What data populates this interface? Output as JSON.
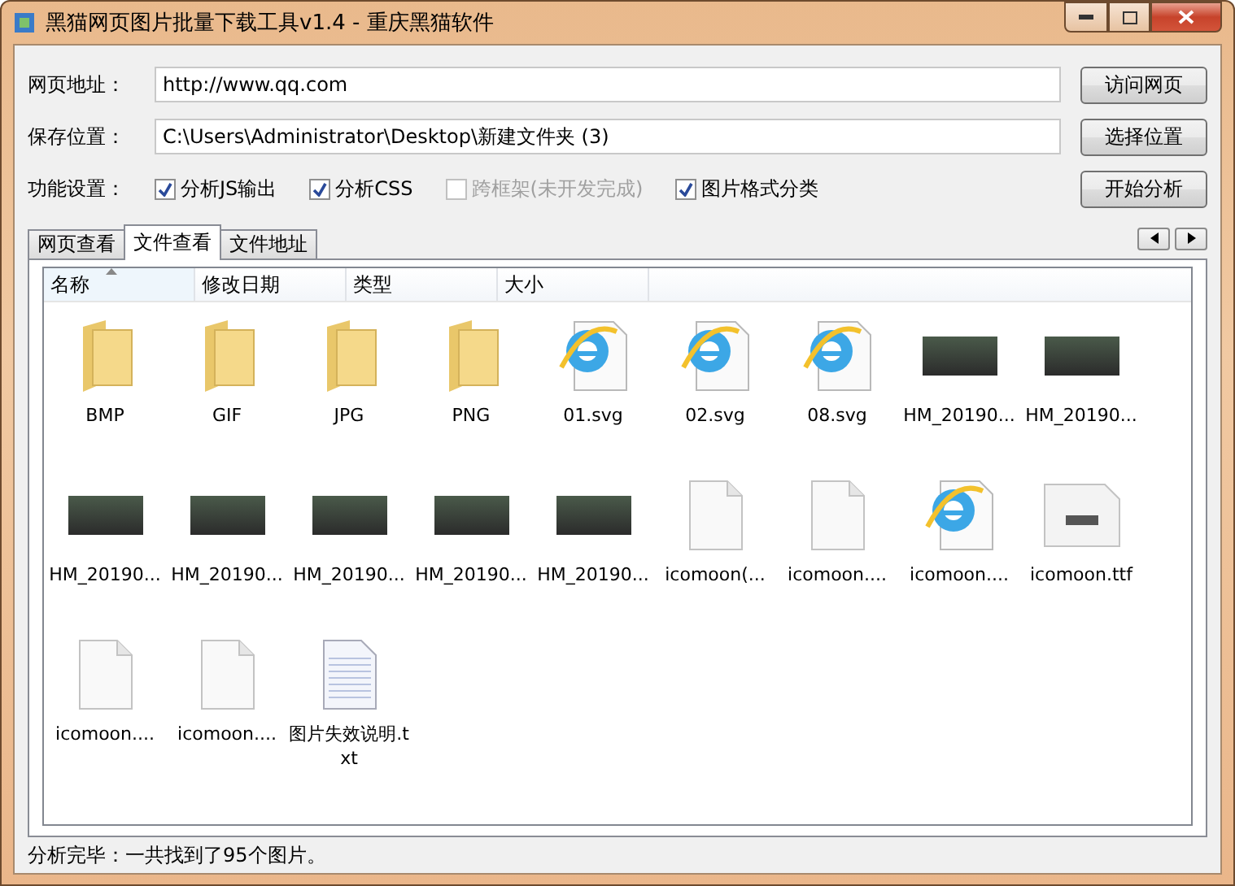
{
  "window": {
    "title": "黑猫网页图片批量下载工具v1.4 - 重庆黑猫软件"
  },
  "url_row": {
    "label": "网页地址：",
    "value": "http://www.qq.com",
    "button": "访问网页"
  },
  "path_row": {
    "label": "保存位置：",
    "value": "C:\\Users\\Administrator\\Desktop\\新建文件夹 (3)",
    "button": "选择位置"
  },
  "options_row": {
    "label": "功能设置：",
    "button": "开始分析",
    "options": [
      {
        "label": "分析JS输出",
        "checked": true,
        "disabled": false
      },
      {
        "label": "分析CSS",
        "checked": true,
        "disabled": false
      },
      {
        "label": "跨框架(未开发完成)",
        "checked": false,
        "disabled": true
      },
      {
        "label": "图片格式分类",
        "checked": true,
        "disabled": false
      }
    ]
  },
  "tabs": [
    {
      "label": "网页查看",
      "selected": false
    },
    {
      "label": "文件查看",
      "selected": true
    },
    {
      "label": "文件地址",
      "selected": false
    }
  ],
  "columns": [
    {
      "label": "名称",
      "sorted": true
    },
    {
      "label": "修改日期",
      "sorted": false
    },
    {
      "label": "类型",
      "sorted": false
    },
    {
      "label": "大小",
      "sorted": false
    }
  ],
  "files": [
    {
      "label": "BMP",
      "kind": "folder"
    },
    {
      "label": "GIF",
      "kind": "folder"
    },
    {
      "label": "JPG",
      "kind": "folder"
    },
    {
      "label": "PNG",
      "kind": "folder"
    },
    {
      "label": "01.svg",
      "kind": "browser"
    },
    {
      "label": "02.svg",
      "kind": "browser"
    },
    {
      "label": "08.svg",
      "kind": "browser"
    },
    {
      "label": "HM_20190...",
      "kind": "photo"
    },
    {
      "label": "HM_20190...",
      "kind": "photo"
    },
    {
      "label": "HM_20190...",
      "kind": "photo"
    },
    {
      "label": "HM_20190...",
      "kind": "photo"
    },
    {
      "label": "HM_20190...",
      "kind": "photo"
    },
    {
      "label": "HM_20190...",
      "kind": "photo"
    },
    {
      "label": "HM_20190...",
      "kind": "photo"
    },
    {
      "label": "icomoon(...",
      "kind": "blank"
    },
    {
      "label": "icomoon....",
      "kind": "blank"
    },
    {
      "label": "icomoon....",
      "kind": "browser"
    },
    {
      "label": "icomoon.ttf",
      "kind": "font"
    },
    {
      "label": "icomoon....",
      "kind": "blank"
    },
    {
      "label": "icomoon....",
      "kind": "blank"
    },
    {
      "label": "图片失效说明.txt",
      "kind": "text"
    }
  ],
  "status_bar": {
    "text": "分析完毕：一共找到了95个图片。"
  }
}
